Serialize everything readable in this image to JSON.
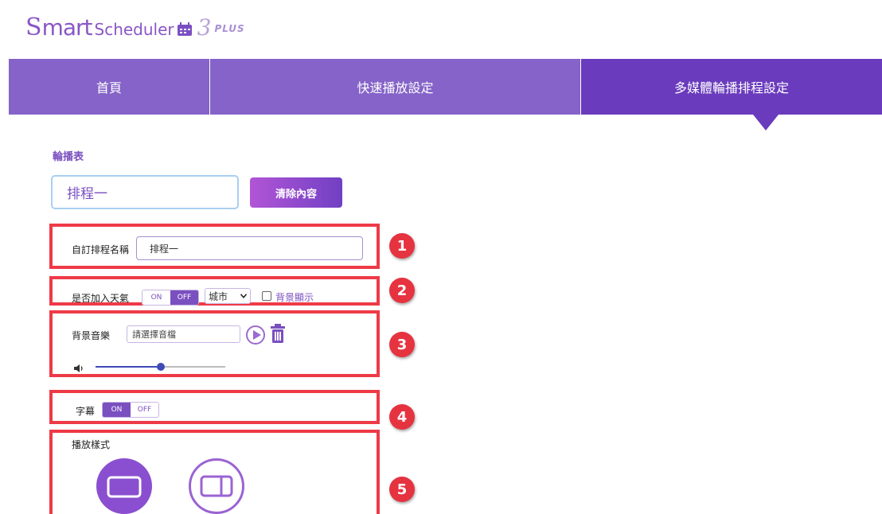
{
  "logo": {
    "s": "S",
    "mart": "mart",
    "scheduler": "Scheduler",
    "version": "3",
    "plus": "PLUS"
  },
  "nav": {
    "tabs": [
      {
        "label": "首頁"
      },
      {
        "label": "快速播放設定"
      },
      {
        "label": "多媒體輪播排程設定"
      }
    ]
  },
  "section_title": "輪播表",
  "schedule": {
    "current": "排程一",
    "clear_label": "清除內容"
  },
  "custom_name": {
    "label": "自訂排程名稱",
    "value": "排程一"
  },
  "weather": {
    "label": "是否加入天氣",
    "on": "ON",
    "off": "OFF",
    "selected": "OFF",
    "city": "城市",
    "bg_label": "背景顯示"
  },
  "music": {
    "label": "背景音樂",
    "placeholder": "請選擇音檔",
    "volume": 0.5
  },
  "subtitle": {
    "label": "字幕",
    "on": "ON",
    "off": "OFF",
    "selected": "ON"
  },
  "play_style": {
    "label": "播放樣式"
  },
  "markers": [
    "1",
    "2",
    "3",
    "4",
    "5"
  ],
  "colors": {
    "accent": "#7a4fc0",
    "nav": "#8563c8",
    "nav_active": "#6a3bbd",
    "highlight": "#ee3a47"
  }
}
